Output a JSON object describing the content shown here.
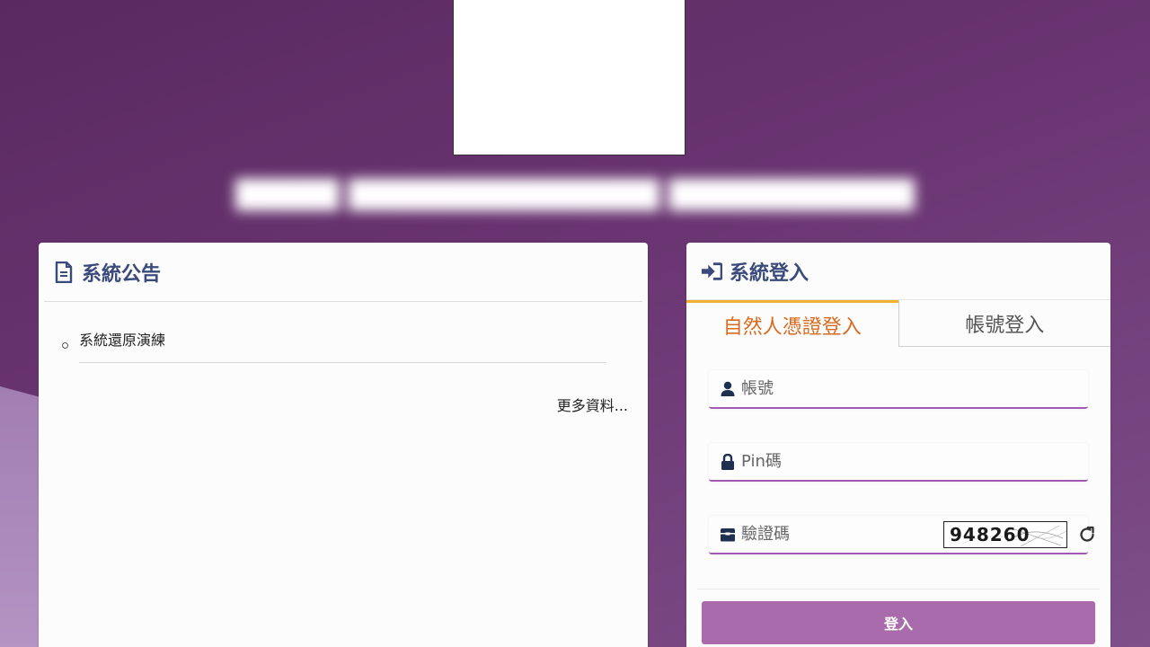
{
  "announcements": {
    "title": "系統公告",
    "items": [
      "系統還原演練"
    ],
    "more_link": "更多資料..."
  },
  "login": {
    "title": "系統登入",
    "tabs": [
      "自然人憑證登入",
      "帳號登入"
    ],
    "active_tab": "自然人憑證登入",
    "account_placeholder": "帳號",
    "pin_placeholder": "Pin碼",
    "captcha_placeholder": "驗證碼",
    "captcha_code": "948260",
    "submit_label": "登入"
  },
  "colors": {
    "accent": "#a96bab",
    "header_text": "#3a4a7a",
    "active_tab_text": "#d96a1f",
    "active_tab_border": "#f0b030"
  },
  "icons": {
    "announcement": "document-icon",
    "login": "sign-in-icon",
    "account": "user-icon",
    "pin": "lock-icon",
    "captcha": "id-card-icon",
    "refresh": "refresh-icon"
  }
}
